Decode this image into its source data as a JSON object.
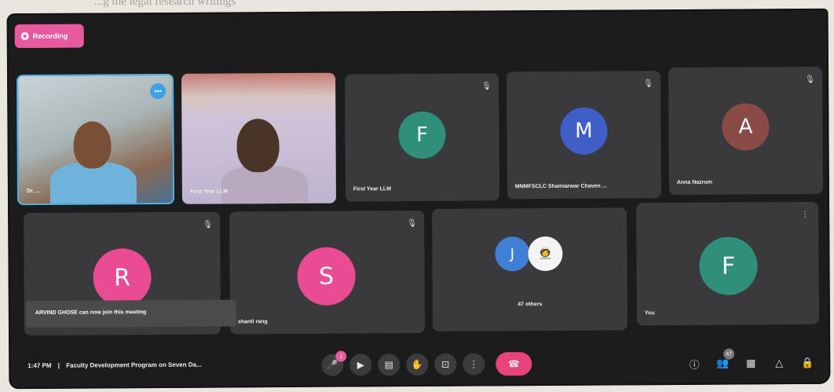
{
  "recording": {
    "label": "Recording"
  },
  "background_text": "...g the legal research writings",
  "tiles": [
    {
      "name": "Dr. ...",
      "type": "video"
    },
    {
      "name": "First Year LLM",
      "type": "video"
    },
    {
      "name": "First Year LLM",
      "initial": "F",
      "color": "#2f8f7a"
    },
    {
      "name": "MNMFSCLC Shamiarwar Chaven ...",
      "initial": "M",
      "color": "#3f5fc6"
    },
    {
      "name": "Anna Nazrum",
      "initial": "A",
      "color": "#8a4a45"
    },
    {
      "name": "",
      "initial": "R",
      "color": "#ea4c93"
    },
    {
      "name": "shanti rang",
      "initial": "S",
      "color": "#ea4c93"
    },
    {
      "name": "47 others",
      "initial": "J",
      "color": "#3f7fd6"
    },
    {
      "name": "You",
      "initial": "F",
      "color": "#2f8f7a"
    }
  ],
  "toast": "ARVIND GHOSE can now join this meeting",
  "bottom": {
    "time": "1:47 PM",
    "separator": "|",
    "meeting_title": "Faculty Development Program on Seven Da...",
    "raise_badge": "1",
    "people_count": "47"
  },
  "colors": {
    "accent": "#e85a9e",
    "end_call": "#e8437d",
    "screen_bg": "#1c1c1d",
    "tile_bg": "#3a3a3c"
  },
  "icons": [
    "mic-icon",
    "camera-icon",
    "captions-icon",
    "raise-hand-icon",
    "present-icon",
    "more-options-icon",
    "end-call-icon",
    "info-icon",
    "people-icon",
    "chat-icon",
    "activities-icon",
    "host-controls-icon"
  ]
}
